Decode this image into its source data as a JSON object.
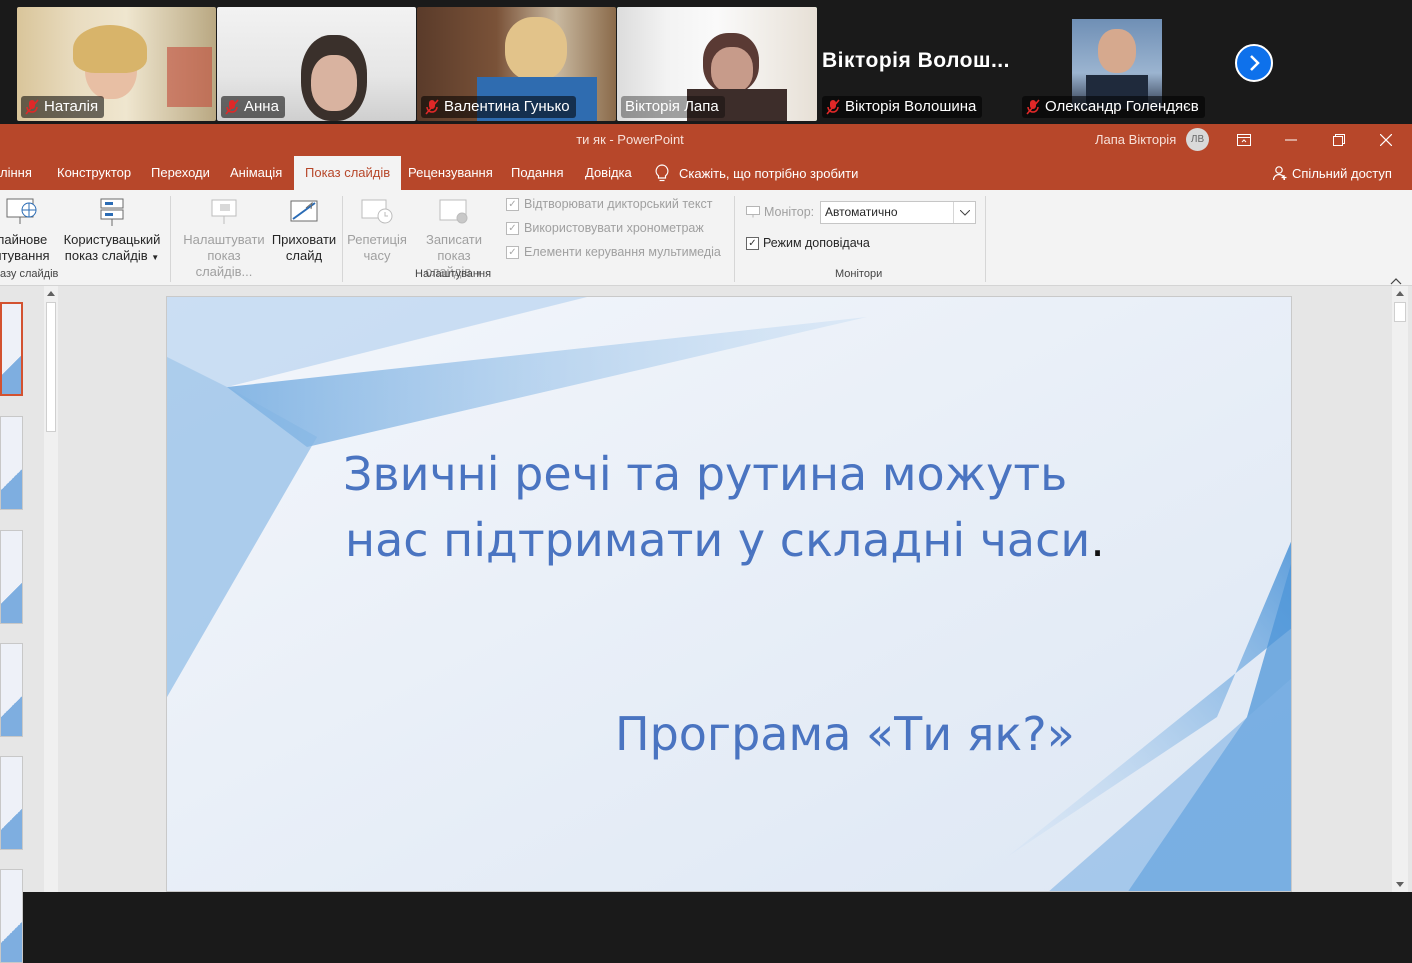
{
  "zoom": {
    "participants": [
      {
        "name": "Наталія",
        "muted": true,
        "video": true
      },
      {
        "name": "Анна",
        "muted": true,
        "video": true
      },
      {
        "name": "Валентина Гунько",
        "muted": true,
        "video": true
      },
      {
        "name": "Вікторія Лапа",
        "muted": false,
        "video": true,
        "active_speaker": true
      },
      {
        "name": "Вікторія Волошина",
        "display_label": "Вікторія  Волош...",
        "muted": true,
        "video": false
      },
      {
        "name": "Олександр Голендяєв",
        "muted": true,
        "video": true
      }
    ],
    "next_page_icon": "chevron-right-icon",
    "accent_color": "#0e71eb",
    "active_border_color": "#2fd25a"
  },
  "window": {
    "doc_title": "ти як  -  PowerPoint",
    "user_name": "Лапа Вікторія",
    "user_initials": "ЛВ",
    "theme_color": "#b7472a"
  },
  "tabs": [
    {
      "label": "ління"
    },
    {
      "label": "Конструктор"
    },
    {
      "label": "Переходи"
    },
    {
      "label": "Анімація"
    },
    {
      "label": "Показ слайдів",
      "active": true
    },
    {
      "label": "Рецензування"
    },
    {
      "label": "Подання"
    },
    {
      "label": "Довідка"
    }
  ],
  "tell_me": "Скажіть, що потрібно зробити",
  "share_label": "Спільний доступ",
  "ribbon": {
    "online_line1": "лайнове",
    "online_line2": "нтування",
    "custom_line1": "Користувацький",
    "custom_line2": "показ слайдів",
    "group_start_label": "азу слайдів",
    "setup_line1": "Налаштувати",
    "setup_line2": "показ слайдів...",
    "hide_line1": "Приховати",
    "hide_line2": "слайд",
    "rehearse_line1": "Репетиція",
    "rehearse_line2": "часу",
    "record_line1": "Записати показ",
    "record_line2": "слайдів",
    "checkboxes": [
      {
        "label": "Відтворювати дикторський текст",
        "checked": true
      },
      {
        "label": "Використовувати хронометраж",
        "checked": true
      },
      {
        "label": "Елементи керування мультимедіа",
        "checked": true
      }
    ],
    "group_setup_label": "Налаштування",
    "monitor_label": "Монітор:",
    "monitor_value": "Автоматично",
    "presenter_label": "Режим доповідача",
    "presenter_checked": true,
    "group_monitors_label": "Монітори"
  },
  "slide": {
    "line1": "Звичні речі та рутина можуть",
    "line2": "нас підтримати у складні  часи",
    "line2_end": ".",
    "subtitle": "Програма  «Ти  як?»",
    "text_color": "#4a74c1"
  }
}
